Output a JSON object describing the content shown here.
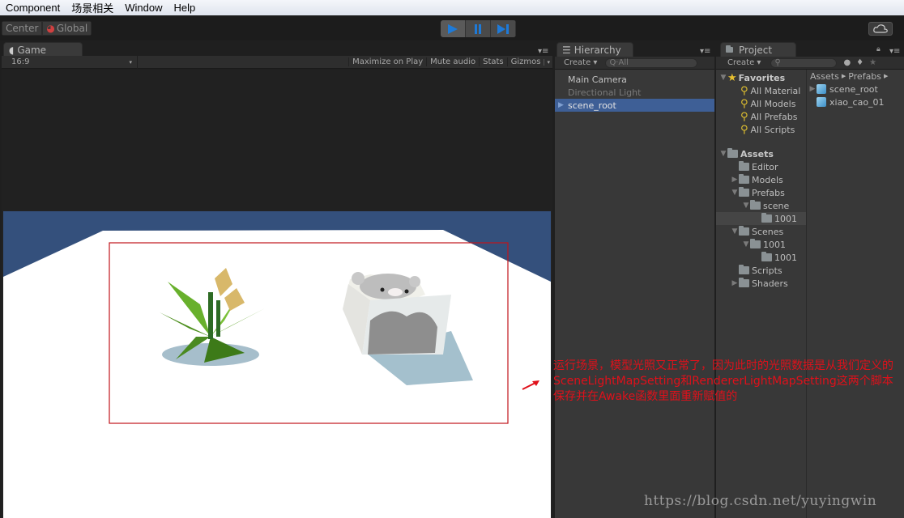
{
  "menubar": {
    "items": [
      "Component",
      "场景相关",
      "Window",
      "Help"
    ]
  },
  "toolbar": {
    "pivot_label": "Center",
    "space_label": "Global",
    "play_icon": "play-icon",
    "pause_icon": "pause-icon",
    "step_icon": "step-icon",
    "cloud_icon": "cloud-icon"
  },
  "game": {
    "tab_label": "Game",
    "aspect": "16:9",
    "buttons": [
      "Maximize on Play",
      "Mute audio",
      "Stats",
      "Gizmos"
    ],
    "colors": {
      "sky": "#34507c",
      "ground": "#ffffff",
      "highlight_box": "#c0141c"
    }
  },
  "hierarchy": {
    "tab_label": "Hierarchy",
    "create_label": "Create",
    "search_placeholder": "Q·All",
    "items": [
      {
        "label": "Main Camera",
        "state": "normal"
      },
      {
        "label": "Directional Light",
        "state": "dim"
      },
      {
        "label": "scene_root",
        "state": "selected"
      }
    ]
  },
  "project": {
    "tab_label": "Project",
    "create_label": "Create",
    "favorites_label": "Favorites",
    "favorites": [
      "All Material",
      "All Models",
      "All Prefabs",
      "All Scripts"
    ],
    "assets_label": "Assets",
    "tree": [
      {
        "label": "Editor",
        "depth": 1,
        "arrow": ""
      },
      {
        "label": "Models",
        "depth": 1,
        "arrow": "right"
      },
      {
        "label": "Prefabs",
        "depth": 1,
        "arrow": "down"
      },
      {
        "label": "scene",
        "depth": 2,
        "arrow": "down"
      },
      {
        "label": "1001",
        "depth": 3,
        "arrow": "",
        "selected": true
      },
      {
        "label": "Scenes",
        "depth": 1,
        "arrow": "down"
      },
      {
        "label": "1001",
        "depth": 2,
        "arrow": "down"
      },
      {
        "label": "1001",
        "depth": 3,
        "arrow": ""
      },
      {
        "label": "Scripts",
        "depth": 1,
        "arrow": ""
      },
      {
        "label": "Shaders",
        "depth": 1,
        "arrow": "right"
      }
    ],
    "breadcrumb": [
      "Assets",
      "Prefabs"
    ],
    "files": [
      "scene_root",
      "xiao_cao_01"
    ]
  },
  "annotation": {
    "text": "运行场景，模型光照又正常了，因为此时的光照数据是从我们定义的SceneLightMapSetting和RendererLightMapSetting这两个脚本保存并在Awake函数里面重新赋值的"
  },
  "watermark": "https://blog.csdn.net/yuyingwin"
}
